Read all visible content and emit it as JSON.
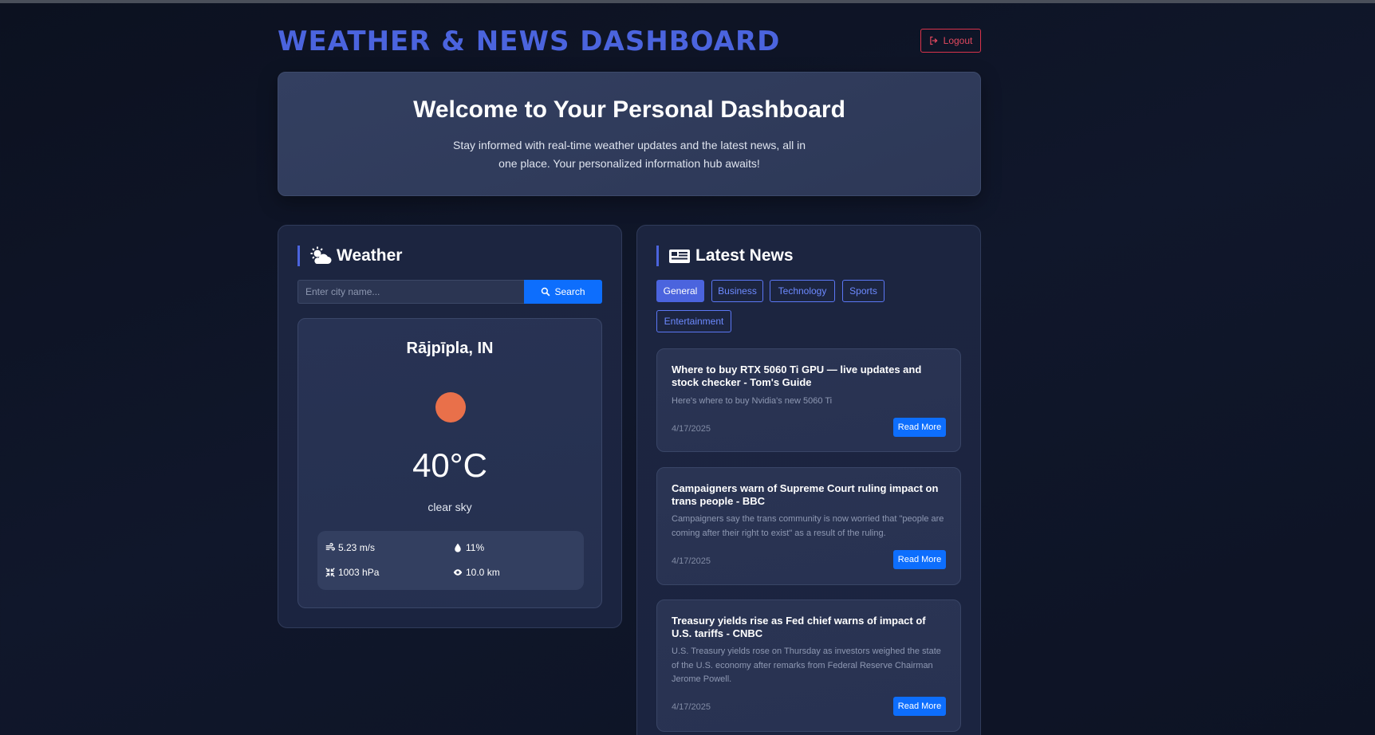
{
  "header": {
    "title": "WEATHER & NEWS DASHBOARD",
    "logout_label": "Logout",
    "logout_icon": "sign-out-icon"
  },
  "hero": {
    "heading": "Welcome to Your Personal Dashboard",
    "text": "Stay informed with real-time weather updates and the latest news, all in one place. Your personalized information hub awaits!"
  },
  "weather": {
    "panel_title": "Weather",
    "panel_icon": "cloud-sun-icon",
    "search_placeholder": "Enter city name...",
    "search_label": "Search",
    "city": "Rājpīpla, IN",
    "temperature": "40°C",
    "description": "clear sky",
    "condition_color": "#e9704a",
    "stats": {
      "wind": "5.23 m/s",
      "humidity": "11%",
      "pressure": "1003 hPa",
      "visibility": "10.0 km"
    }
  },
  "news": {
    "panel_title": "Latest News",
    "panel_icon": "newspaper-icon",
    "categories": [
      "General",
      "Business",
      "Technology",
      "Sports",
      "Entertainment"
    ],
    "active_category": "General",
    "articles": [
      {
        "title": "Where to buy RTX 5060 Ti GPU — live updates and stock checker - Tom's Guide",
        "description": "Here's where to buy Nvidia's new 5060 Ti",
        "date": "4/17/2025",
        "button": "Read More"
      },
      {
        "title": "Campaigners warn of Supreme Court ruling impact on trans people - BBC",
        "description": "Campaigners say the trans community is now worried that \"people are coming after their right to exist\" as a result of the ruling.",
        "date": "4/17/2025",
        "button": "Read More"
      },
      {
        "title": "Treasury yields rise as Fed chief warns of impact of U.S. tariffs - CNBC",
        "description": "U.S. Treasury yields rose on Thursday as investors weighed the state of the U.S. economy after remarks from Federal Reserve Chairman Jerome Powell.",
        "date": "4/17/2025",
        "button": "Read More"
      }
    ]
  },
  "colors": {
    "accent": "#4b64de",
    "primary_button": "#0d6efd",
    "logout": "#e0485e"
  }
}
